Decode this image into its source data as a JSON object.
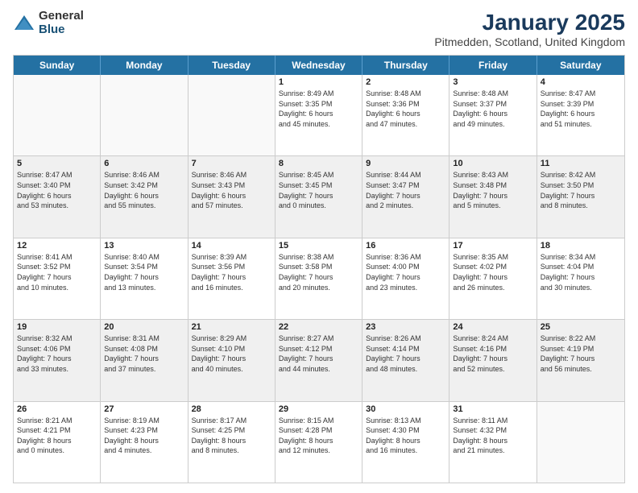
{
  "logo": {
    "general": "General",
    "blue": "Blue"
  },
  "title": {
    "month_year": "January 2025",
    "location": "Pitmedden, Scotland, United Kingdom"
  },
  "weekdays": [
    "Sunday",
    "Monday",
    "Tuesday",
    "Wednesday",
    "Thursday",
    "Friday",
    "Saturday"
  ],
  "weeks": [
    [
      {
        "day": "",
        "info": "",
        "empty": true
      },
      {
        "day": "",
        "info": "",
        "empty": true
      },
      {
        "day": "",
        "info": "",
        "empty": true
      },
      {
        "day": "1",
        "info": "Sunrise: 8:49 AM\nSunset: 3:35 PM\nDaylight: 6 hours\nand 45 minutes.",
        "empty": false
      },
      {
        "day": "2",
        "info": "Sunrise: 8:48 AM\nSunset: 3:36 PM\nDaylight: 6 hours\nand 47 minutes.",
        "empty": false
      },
      {
        "day": "3",
        "info": "Sunrise: 8:48 AM\nSunset: 3:37 PM\nDaylight: 6 hours\nand 49 minutes.",
        "empty": false
      },
      {
        "day": "4",
        "info": "Sunrise: 8:47 AM\nSunset: 3:39 PM\nDaylight: 6 hours\nand 51 minutes.",
        "empty": false
      }
    ],
    [
      {
        "day": "5",
        "info": "Sunrise: 8:47 AM\nSunset: 3:40 PM\nDaylight: 6 hours\nand 53 minutes.",
        "empty": false
      },
      {
        "day": "6",
        "info": "Sunrise: 8:46 AM\nSunset: 3:42 PM\nDaylight: 6 hours\nand 55 minutes.",
        "empty": false
      },
      {
        "day": "7",
        "info": "Sunrise: 8:46 AM\nSunset: 3:43 PM\nDaylight: 6 hours\nand 57 minutes.",
        "empty": false
      },
      {
        "day": "8",
        "info": "Sunrise: 8:45 AM\nSunset: 3:45 PM\nDaylight: 7 hours\nand 0 minutes.",
        "empty": false
      },
      {
        "day": "9",
        "info": "Sunrise: 8:44 AM\nSunset: 3:47 PM\nDaylight: 7 hours\nand 2 minutes.",
        "empty": false
      },
      {
        "day": "10",
        "info": "Sunrise: 8:43 AM\nSunset: 3:48 PM\nDaylight: 7 hours\nand 5 minutes.",
        "empty": false
      },
      {
        "day": "11",
        "info": "Sunrise: 8:42 AM\nSunset: 3:50 PM\nDaylight: 7 hours\nand 8 minutes.",
        "empty": false
      }
    ],
    [
      {
        "day": "12",
        "info": "Sunrise: 8:41 AM\nSunset: 3:52 PM\nDaylight: 7 hours\nand 10 minutes.",
        "empty": false
      },
      {
        "day": "13",
        "info": "Sunrise: 8:40 AM\nSunset: 3:54 PM\nDaylight: 7 hours\nand 13 minutes.",
        "empty": false
      },
      {
        "day": "14",
        "info": "Sunrise: 8:39 AM\nSunset: 3:56 PM\nDaylight: 7 hours\nand 16 minutes.",
        "empty": false
      },
      {
        "day": "15",
        "info": "Sunrise: 8:38 AM\nSunset: 3:58 PM\nDaylight: 7 hours\nand 20 minutes.",
        "empty": false
      },
      {
        "day": "16",
        "info": "Sunrise: 8:36 AM\nSunset: 4:00 PM\nDaylight: 7 hours\nand 23 minutes.",
        "empty": false
      },
      {
        "day": "17",
        "info": "Sunrise: 8:35 AM\nSunset: 4:02 PM\nDaylight: 7 hours\nand 26 minutes.",
        "empty": false
      },
      {
        "day": "18",
        "info": "Sunrise: 8:34 AM\nSunset: 4:04 PM\nDaylight: 7 hours\nand 30 minutes.",
        "empty": false
      }
    ],
    [
      {
        "day": "19",
        "info": "Sunrise: 8:32 AM\nSunset: 4:06 PM\nDaylight: 7 hours\nand 33 minutes.",
        "empty": false
      },
      {
        "day": "20",
        "info": "Sunrise: 8:31 AM\nSunset: 4:08 PM\nDaylight: 7 hours\nand 37 minutes.",
        "empty": false
      },
      {
        "day": "21",
        "info": "Sunrise: 8:29 AM\nSunset: 4:10 PM\nDaylight: 7 hours\nand 40 minutes.",
        "empty": false
      },
      {
        "day": "22",
        "info": "Sunrise: 8:27 AM\nSunset: 4:12 PM\nDaylight: 7 hours\nand 44 minutes.",
        "empty": false
      },
      {
        "day": "23",
        "info": "Sunrise: 8:26 AM\nSunset: 4:14 PM\nDaylight: 7 hours\nand 48 minutes.",
        "empty": false
      },
      {
        "day": "24",
        "info": "Sunrise: 8:24 AM\nSunset: 4:16 PM\nDaylight: 7 hours\nand 52 minutes.",
        "empty": false
      },
      {
        "day": "25",
        "info": "Sunrise: 8:22 AM\nSunset: 4:19 PM\nDaylight: 7 hours\nand 56 minutes.",
        "empty": false
      }
    ],
    [
      {
        "day": "26",
        "info": "Sunrise: 8:21 AM\nSunset: 4:21 PM\nDaylight: 8 hours\nand 0 minutes.",
        "empty": false
      },
      {
        "day": "27",
        "info": "Sunrise: 8:19 AM\nSunset: 4:23 PM\nDaylight: 8 hours\nand 4 minutes.",
        "empty": false
      },
      {
        "day": "28",
        "info": "Sunrise: 8:17 AM\nSunset: 4:25 PM\nDaylight: 8 hours\nand 8 minutes.",
        "empty": false
      },
      {
        "day": "29",
        "info": "Sunrise: 8:15 AM\nSunset: 4:28 PM\nDaylight: 8 hours\nand 12 minutes.",
        "empty": false
      },
      {
        "day": "30",
        "info": "Sunrise: 8:13 AM\nSunset: 4:30 PM\nDaylight: 8 hours\nand 16 minutes.",
        "empty": false
      },
      {
        "day": "31",
        "info": "Sunrise: 8:11 AM\nSunset: 4:32 PM\nDaylight: 8 hours\nand 21 minutes.",
        "empty": false
      },
      {
        "day": "",
        "info": "",
        "empty": true
      }
    ]
  ]
}
